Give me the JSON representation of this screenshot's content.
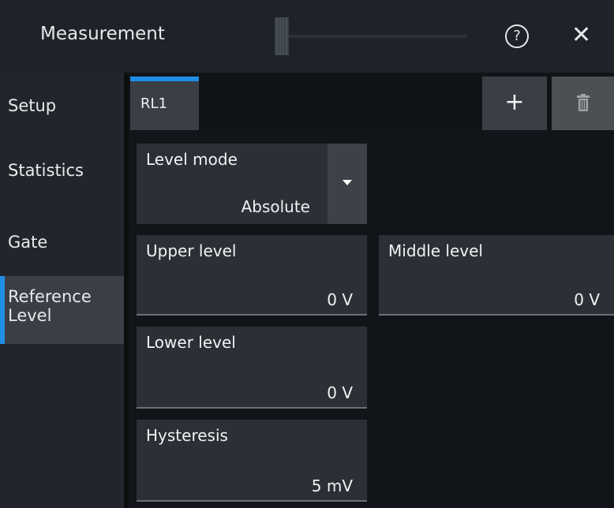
{
  "window": {
    "title": "Measurement",
    "help_glyph": "?",
    "close_glyph": "✕"
  },
  "sidebar": {
    "items": [
      {
        "label": "Setup"
      },
      {
        "label": "Statistics"
      },
      {
        "label": "Gate"
      },
      {
        "label": "Reference Level",
        "line1": "Reference",
        "line2": "Level",
        "active": true
      }
    ]
  },
  "tabs": {
    "active_tab": "RL1",
    "add_glyph": "+"
  },
  "level_mode": {
    "label": "Level mode",
    "value": "Absolute"
  },
  "upper_level": {
    "label": "Upper level",
    "value": "0 V"
  },
  "middle_level": {
    "label": "Middle level",
    "value": "0 V"
  },
  "lower_level": {
    "label": "Lower level",
    "value": "0 V"
  },
  "hysteresis": {
    "label": "Hysteresis",
    "value": "5 mV"
  },
  "colors": {
    "accent": "#1f8ee6",
    "panel": "#2c3036",
    "background": "#111418"
  },
  "icons": {
    "help": "help-icon",
    "close": "close-icon",
    "add": "plus-icon",
    "delete": "trash-icon",
    "dropdown": "chevron-down-icon"
  }
}
